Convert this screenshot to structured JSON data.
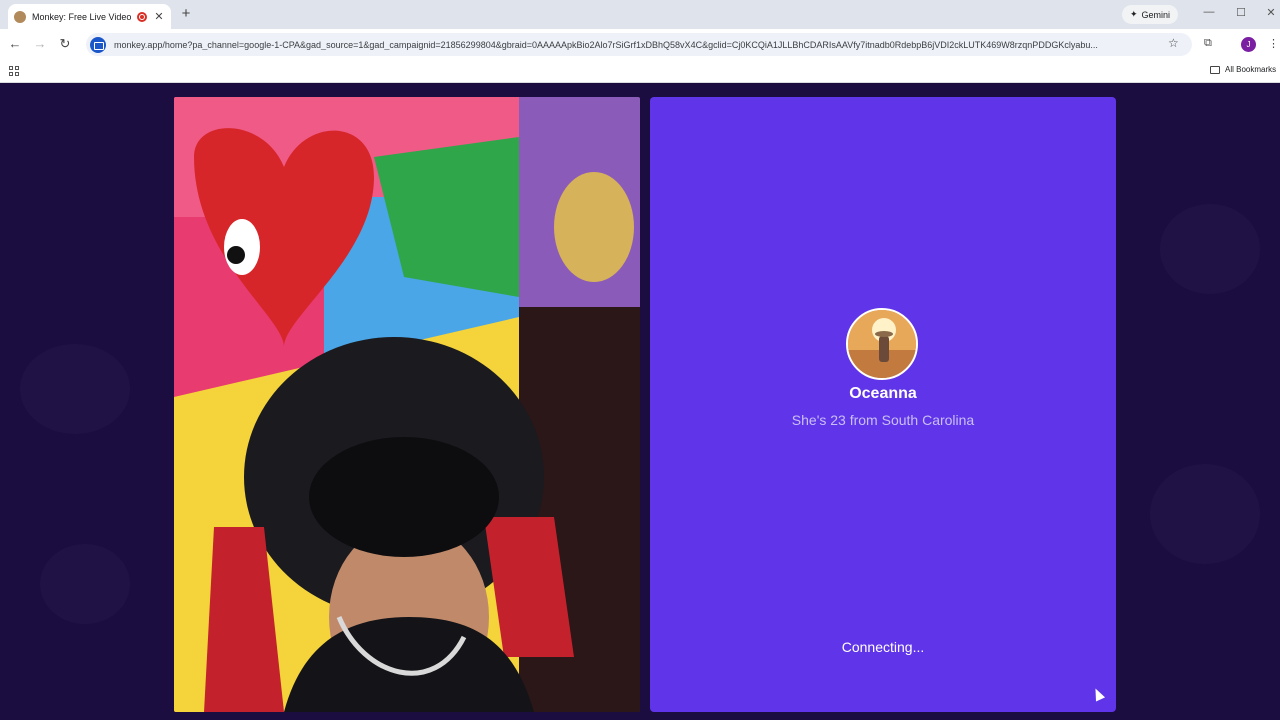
{
  "browser": {
    "tab_title": "Monkey: Free Live Video Ch",
    "url": "monkey.app/home?pa_channel=google-1-CPA&gad_source=1&gad_campaignid=21856299804&gbraid=0AAAAApkBio2Alo7rSiGrf1xDBhQ58vX4C&gclid=Cj0KCQiA1JLLBhCDARIsAAVfy7itnadb0RdebpB6jVDI2ckLUTK469W8rzqnPDDGKclyabu...",
    "gemini_label": "Gemini",
    "all_bookmarks_label": "All Bookmarks",
    "profile_initial": "J"
  },
  "call": {
    "match_name": "Oceanna",
    "match_subtitle": "She's 23 from South Carolina",
    "status": "Connecting..."
  }
}
